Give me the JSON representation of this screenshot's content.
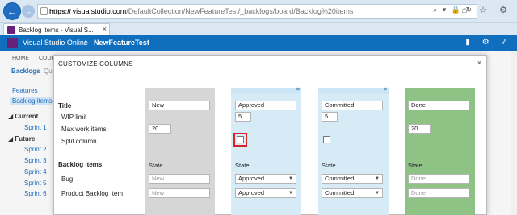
{
  "browser": {
    "url_scheme": "https://",
    "url_host": "visualstudio.com",
    "url_path": "/DefaultCollection/NewFeatureTest/_backlogs/board/Backlog%20items",
    "address_icons": "⌕ ▾ 🔒 ↻",
    "chrome_icons": "⌂ ☆ ⚙",
    "tab_title": "Backlog items - Visual S...",
    "tab_close": "×"
  },
  "header": {
    "app_title": "Visual Studio Online",
    "separator": "/",
    "project": "NewFeatureTest",
    "icons": "▮ ⚙ ?"
  },
  "hubs": {
    "home": "HOME",
    "code": "CODE"
  },
  "page_tabs": {
    "backlogs": "Backlogs",
    "queries": "Qu"
  },
  "left_nav": {
    "features": "Features",
    "backlog_items": "Backlog items",
    "current": "◢ Current",
    "sprint1": "Sprint 1",
    "future": "◢ Future",
    "sprints": [
      "Sprint 2",
      "Sprint 3",
      "Sprint 4",
      "Sprint 5",
      "Sprint 6"
    ]
  },
  "dialog": {
    "title": "CUSTOMIZE COLUMNS",
    "close": "×",
    "rows": {
      "title": "Title",
      "wip": "WIP limit",
      "max": "Max work items",
      "split": "Split column",
      "backlog": "Backlog items",
      "bug": "Bug",
      "pbi": "Product Backlog Item"
    },
    "columns": {
      "new": {
        "title": "New",
        "max": "20",
        "state_label": "State",
        "bug_state": "New",
        "pbi_state": "New"
      },
      "approved": {
        "title": "Approved",
        "wip": "5",
        "state_label": "State",
        "bug_state": "Approved",
        "pbi_state": "Approved",
        "remove": "×"
      },
      "committed": {
        "title": "Committed",
        "wip": "5",
        "state_label": "State",
        "bug_state": "Committed",
        "pbi_state": "Committed",
        "remove": "×"
      },
      "done": {
        "title": "Done",
        "max": "20",
        "state_label": "State",
        "bug_state": "Done",
        "pbi_state": "Done"
      }
    },
    "caret": "▼"
  },
  "colors": {
    "header_blue": "#106ebe",
    "new_col": "#d6d6d6",
    "inprogress_col": "#d7ebf7",
    "done_col": "#8fc285",
    "highlight_red": "#d9252a"
  }
}
